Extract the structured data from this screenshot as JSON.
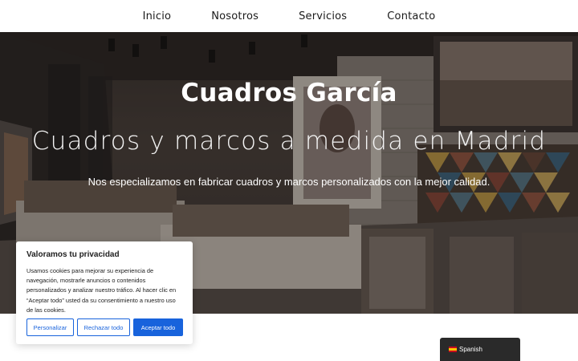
{
  "nav": {
    "items": [
      "Inicio",
      "Nosotros",
      "Servicios",
      "Contacto"
    ]
  },
  "hero": {
    "title": "Cuadros García",
    "subtitle": "Cuadros y marcos a medida en Madrid",
    "tagline": "Nos especializamos en fabricar cuadros y marcos personalizados con la mejor calidad."
  },
  "cookie": {
    "title": "Valoramos tu privacidad",
    "text": "Usamos cookies para mejorar su experiencia de navegación, mostrarle anuncios o contenidos personalizados y analizar nuestro tráfico. Al hacer clic en “Aceptar todo” usted da su consentimiento a nuestro uso de las cookies.",
    "customize_label": "Personalizar",
    "reject_label": "Rechazar todo",
    "accept_label": "Aceptar todo"
  },
  "language": {
    "label": "Spanish",
    "flag_icon": "spain-flag-icon"
  },
  "colors": {
    "accent": "#1863dc",
    "lang_bar": "#2a2a2a"
  }
}
